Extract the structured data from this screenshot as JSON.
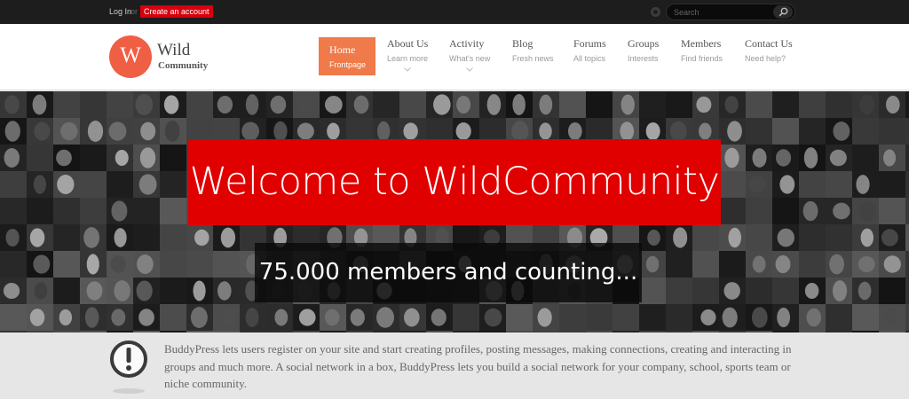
{
  "topbar": {
    "login_label": "Log In",
    "or_label": "or",
    "create_label": "Create an account",
    "search_placeholder": "Search"
  },
  "logo": {
    "initial": "W",
    "name_line1": "Wild",
    "name_line2": "Community"
  },
  "nav": {
    "items": [
      {
        "title": "Home",
        "sub": "Frontpage"
      },
      {
        "title": "About Us",
        "sub": "Learn more"
      },
      {
        "title": "Activity",
        "sub": "What's new"
      },
      {
        "title": "Blog",
        "sub": "Fresh news"
      },
      {
        "title": "Forums",
        "sub": "All topics"
      },
      {
        "title": "Groups",
        "sub": "Interests"
      },
      {
        "title": "Members",
        "sub": "Find friends"
      },
      {
        "title": "Contact Us",
        "sub": "Need help?"
      }
    ]
  },
  "hero": {
    "headline": "Welcome to WildCommunity",
    "subline": "75.000 members and counting..."
  },
  "info": {
    "text": "BuddyPress lets users register on your site and start creating profiles, posting messages, making connections, creating and interacting in groups and much more. A social network in a box, BuddyPress lets you build a social network for your company, school, sports team or niche community."
  },
  "colors": {
    "accent_red": "#e00000",
    "accent_orange": "#f07a4a",
    "logo_orange": "#ef5f44",
    "topbar": "#1d1d1d"
  },
  "icons": [
    "circle-icon",
    "search-icon",
    "chevron-down-icon",
    "exclamation-icon"
  ]
}
